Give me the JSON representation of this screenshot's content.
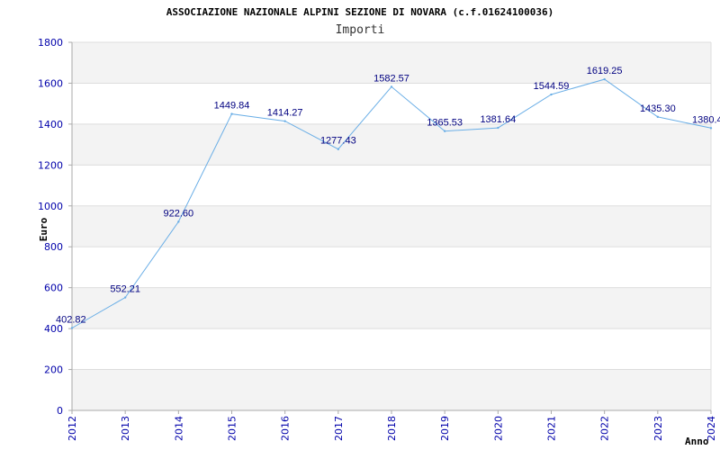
{
  "chart_data": {
    "type": "line",
    "title": "ASSOCIAZIONE NAZIONALE ALPINI SEZIONE DI NOVARA (c.f.01624100036)",
    "subtitle": "Importi",
    "xlabel": "Anno",
    "ylabel": "Euro",
    "ylim": [
      0,
      1800
    ],
    "yticks": [
      0,
      200,
      400,
      600,
      800,
      1000,
      1200,
      1400,
      1600,
      1800
    ],
    "grid": true,
    "categories": [
      "2012",
      "2013",
      "2014",
      "2015",
      "2016",
      "2017",
      "2018",
      "2019",
      "2020",
      "2021",
      "2022",
      "2023",
      "2024"
    ],
    "series": [
      {
        "values": [
          402.82,
          552.21,
          922.6,
          1449.84,
          1414.27,
          1277.43,
          1582.57,
          1365.53,
          1381.64,
          1544.59,
          1619.25,
          1435.3,
          1380.4
        ],
        "labels": [
          "402.82",
          "552.21",
          "922.60",
          "1449.84",
          "1414.27",
          "1277.43",
          "1582.57",
          "1365.53",
          "1381.64",
          "1544.59",
          "1619.25",
          "1435.30",
          "1380.4"
        ]
      }
    ],
    "colors": {
      "line": "#6aaee6",
      "band": "#f3f3f3",
      "grid": "#dddddd",
      "axis": "#aaaaaa",
      "tick_text": "#0000aa",
      "label_text": "#000080"
    }
  }
}
